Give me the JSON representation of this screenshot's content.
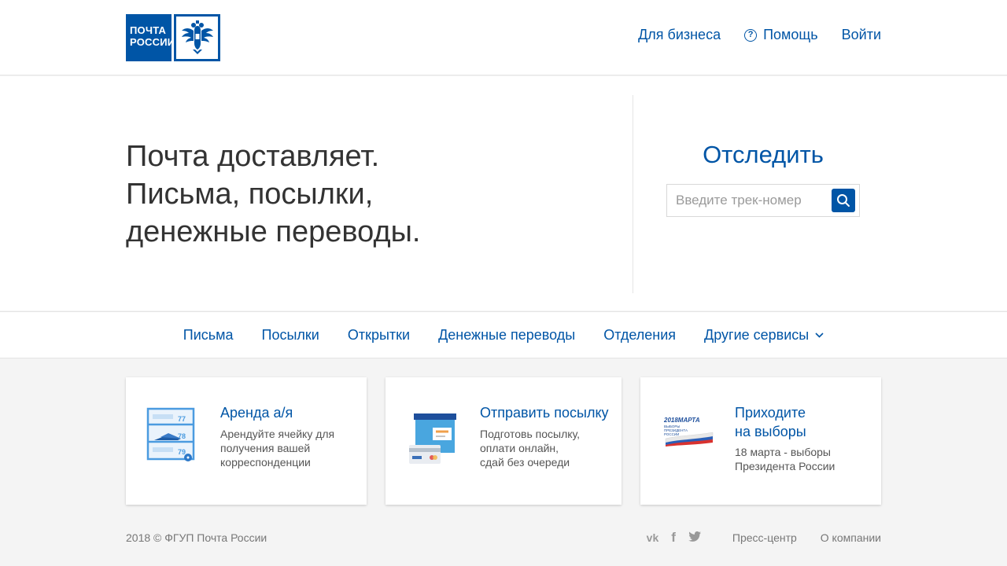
{
  "header": {
    "logo_line1": "ПОЧТА",
    "logo_line2": "РОССИИ",
    "nav": {
      "business": "Для бизнеса",
      "help": "Помощь",
      "login": "Войти"
    }
  },
  "hero": {
    "line1": "Почта доставляет.",
    "line2": "Письма, посылки,",
    "line3": "денежные переводы."
  },
  "track": {
    "title": "Отследить",
    "placeholder": "Введите трек-номер",
    "value": ""
  },
  "main_nav": {
    "letters": "Письма",
    "parcels": "Посылки",
    "postcards": "Открытки",
    "transfers": "Денежные переводы",
    "offices": "Отделения",
    "other": "Другие сервисы"
  },
  "cards": [
    {
      "title": "Аренда а/я",
      "desc": "Арендуйте ячейку для\nполучения вашей\nкорреспонденции",
      "icon_numbers": [
        "77",
        "78",
        "79"
      ]
    },
    {
      "title": "Отправить посылку",
      "desc": "Подготовь посылку,\nоплати онлайн,\nсдай без очереди"
    },
    {
      "title": "Приходите\nна выборы",
      "desc": "18 марта - выборы\nПрезидента России",
      "icon_text1": "2018МАРТА",
      "icon_text2": "ВЫБОРЫ\nПРЕЗИДЕНТА\nРОССИИ"
    }
  ],
  "footer": {
    "copyright": "2018 © ФГУП Почта России",
    "social": {
      "vk": "vk",
      "facebook": "f",
      "twitter": "t"
    },
    "press": "Пресс-центр",
    "about": "О компании"
  },
  "colors": {
    "brand_blue": "#0055a6",
    "background": "#f4f4f4"
  }
}
